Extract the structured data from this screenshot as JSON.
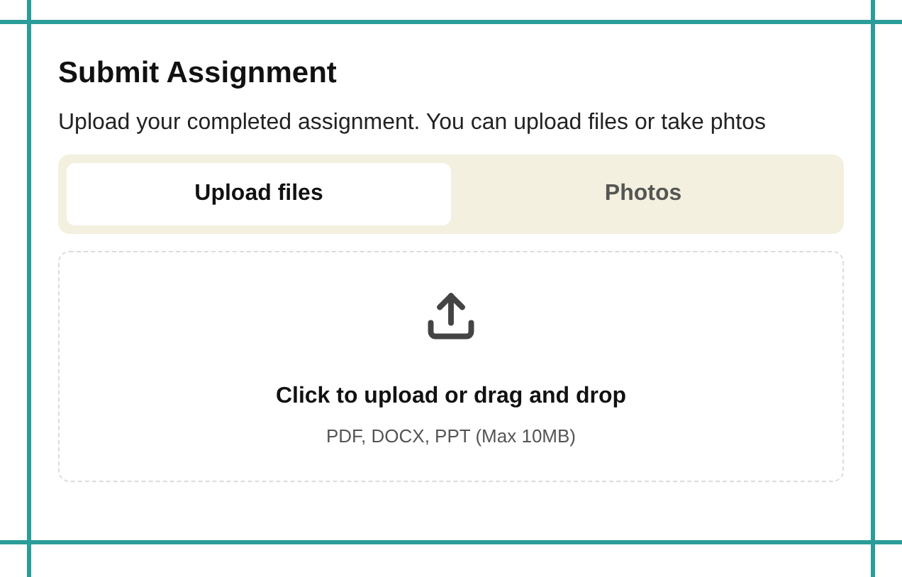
{
  "title": "Submit Assignment",
  "description": "Upload your completed assignment. You can upload files or take phtos",
  "tabs": [
    {
      "label": "Upload files",
      "selected": true
    },
    {
      "label": "Photos",
      "selected": false
    }
  ],
  "dropzone": {
    "prompt": "Click to upload or drag and drop",
    "hint": "PDF, DOCX, PPT (Max 10MB)"
  }
}
